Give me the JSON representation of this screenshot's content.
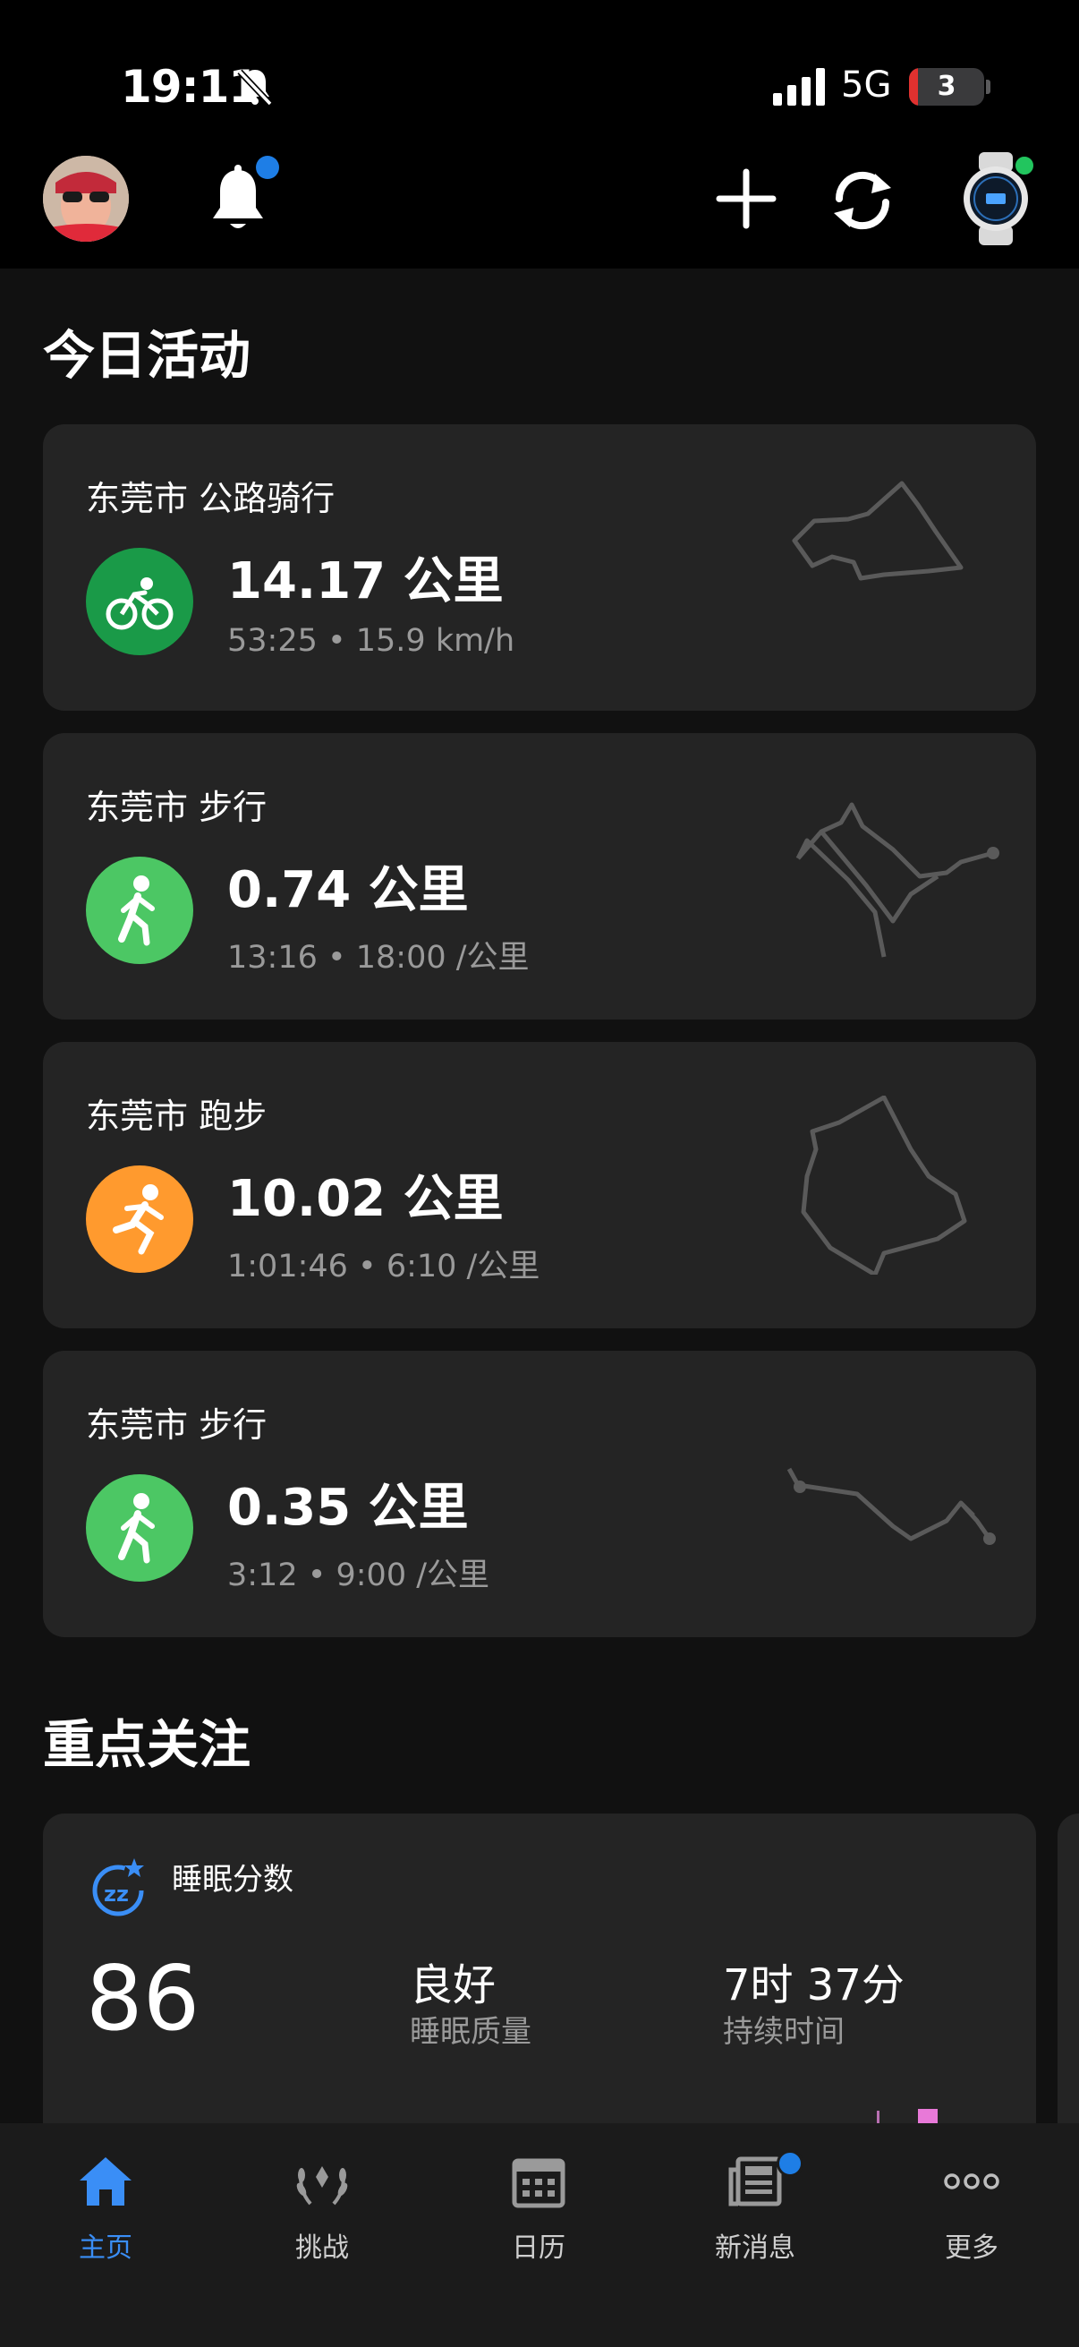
{
  "status_bar": {
    "time": "19:11",
    "network": "5G",
    "battery_level": "3"
  },
  "sections": {
    "today_title": "今日活动",
    "focus_title": "重点关注"
  },
  "activities": [
    {
      "location": "东莞市 公路骑行",
      "distance": "14.17 公里",
      "detail": "53:25 • 15.9 km/h",
      "type": "cycling",
      "color": "#1a9a48"
    },
    {
      "location": "东莞市 步行",
      "distance": "0.74 公里",
      "detail": "13:16 • 18:00 /公里",
      "type": "walking",
      "color": "#4cc764"
    },
    {
      "location": "东莞市 跑步",
      "distance": "10.02 公里",
      "detail": "1:01:46 • 6:10 /公里",
      "type": "running",
      "color": "#ff9a2e"
    },
    {
      "location": "东莞市 步行",
      "distance": "0.35 公里",
      "detail": "3:12 • 9:00 /公里",
      "type": "walking",
      "color": "#4cc764"
    }
  ],
  "sleep": {
    "title": "睡眠分数",
    "score": "86",
    "quality_value": "良好",
    "quality_label": "睡眠质量",
    "duration_value": "7时 37分",
    "duration_label": "持续时间"
  },
  "nav": {
    "home": "主页",
    "challenges": "挑战",
    "calendar": "日历",
    "news": "新消息",
    "more": "更多"
  },
  "colors": {
    "accent_blue": "#3a8ef6",
    "badge_blue": "#1e7ee6",
    "online_green": "#22c55e"
  }
}
